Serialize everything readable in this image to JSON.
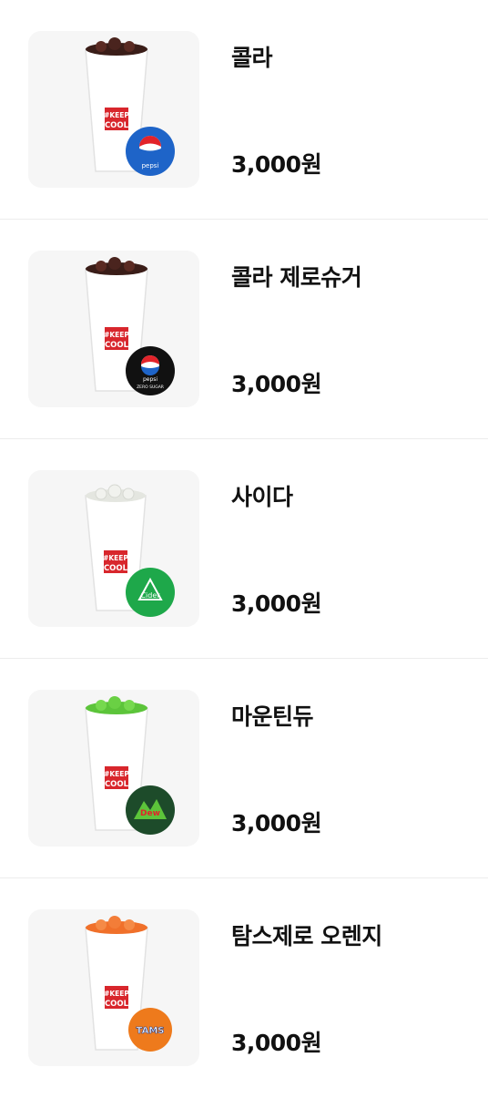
{
  "menu": {
    "items": [
      {
        "name": "콜라",
        "price": "3,000원",
        "cup_text_1": "#KEEP",
        "cup_text_2": "COOL",
        "logo_icon": "pepsi-logo-icon",
        "drink_color": "#3a1d18",
        "logo_color": "#1e64c8"
      },
      {
        "name": "콜라 제로슈거",
        "price": "3,000원",
        "cup_text_1": "#KEEP",
        "cup_text_2": "COOL",
        "logo_icon": "pepsi-zero-sugar-logo-icon",
        "drink_color": "#3a1d18",
        "logo_color": "#111111"
      },
      {
        "name": "사이다",
        "price": "3,000원",
        "cup_text_1": "#KEEP",
        "cup_text_2": "COOL",
        "logo_icon": "chilsung-cider-logo-icon",
        "drink_color": "#e4e6e0",
        "logo_color": "#1ea84a"
      },
      {
        "name": "마운틴듀",
        "price": "3,000원",
        "cup_text_1": "#KEEP",
        "cup_text_2": "COOL",
        "logo_icon": "mountain-dew-logo-icon",
        "drink_color": "#5cc43a",
        "logo_color": "#1d4b2a"
      },
      {
        "name": "탐스제로 오렌지",
        "price": "3,000원",
        "cup_text_1": "#KEEP",
        "cup_text_2": "COOL",
        "logo_icon": "tams-logo-icon",
        "drink_color": "#f0702a",
        "logo_color": "#ee7a1c"
      }
    ]
  },
  "colors": {
    "background": "#ffffff",
    "thumb_background": "#f6f6f6",
    "divider": "#ececec",
    "text": "#111111",
    "keep_cool_red": "#d8262c"
  }
}
